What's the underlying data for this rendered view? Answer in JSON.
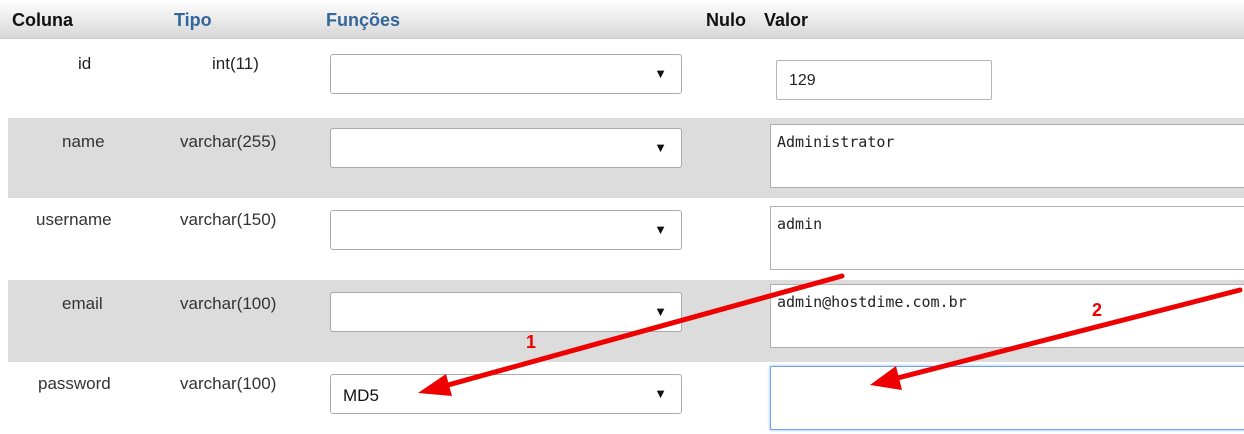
{
  "headers": {
    "coluna": "Coluna",
    "tipo": "Tipo",
    "funcoes": "Funções",
    "nulo": "Nulo",
    "valor": "Valor"
  },
  "rows": [
    {
      "column": "id",
      "type": "int(11)",
      "function": "",
      "value": "129"
    },
    {
      "column": "name",
      "type": "varchar(255)",
      "function": "",
      "value": "Administrator"
    },
    {
      "column": "username",
      "type": "varchar(150)",
      "function": "",
      "value": "admin"
    },
    {
      "column": "email",
      "type": "varchar(100)",
      "function": "",
      "value": "admin@hostdime.com.br"
    },
    {
      "column": "password",
      "type": "varchar(100)",
      "function": "MD5",
      "value": ""
    }
  ],
  "annotations": {
    "arrow1_label": "1",
    "arrow2_label": "2",
    "color": "#ee0000"
  },
  "colors": {
    "header_link": "#336699",
    "row_alt": "#dcdcdc"
  },
  "icons": {
    "dropdown": "triangle-down-icon"
  }
}
